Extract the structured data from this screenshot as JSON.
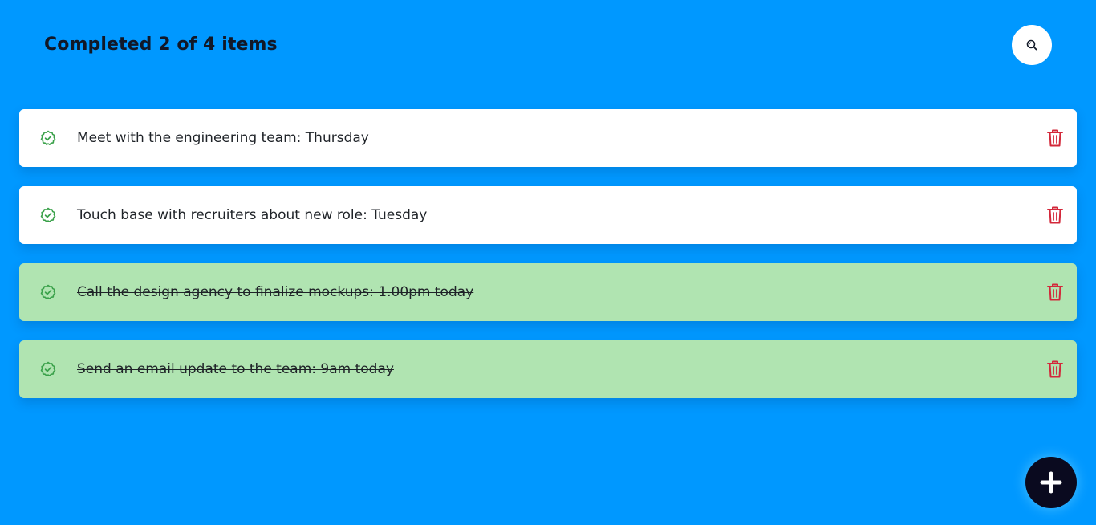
{
  "header": {
    "title": "Completed 2 of 4 items"
  },
  "todos": [
    {
      "text": "Meet with the engineering team: Thursday",
      "completed": false
    },
    {
      "text": "Touch base with recruiters about new role: Tuesday",
      "completed": false
    },
    {
      "text": "Call the design agency to finalize mockups: 1.00pm today",
      "completed": true
    },
    {
      "text": "Send an email update to the team: 9am today",
      "completed": true
    }
  ],
  "icons": {
    "search": "search-icon",
    "check": "check-badge-icon",
    "delete": "trash-icon",
    "add": "plus-icon"
  },
  "colors": {
    "background": "#0098ff",
    "open_item": "#ffffff",
    "done_item": "#b0e4b1",
    "check": "#3aa14a",
    "delete": "#d3283a",
    "add_button": "#0a0a1f"
  }
}
